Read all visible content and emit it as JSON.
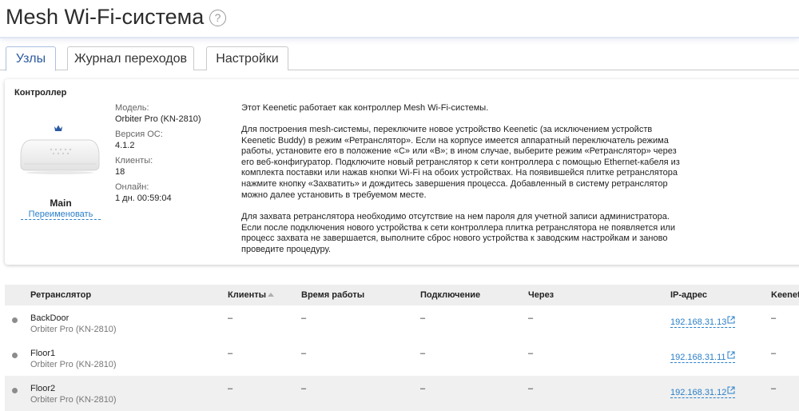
{
  "page": {
    "title": "Mesh Wi-Fi-система",
    "help_glyph": "?"
  },
  "tabs": [
    {
      "label": "Узлы",
      "active": true
    },
    {
      "label": "Журнал переходов",
      "active": false
    },
    {
      "label": "Настройки",
      "active": false
    }
  ],
  "controller": {
    "section_title": "Контроллер",
    "name": "Main",
    "rename_label": "Переименовать",
    "model_label": "Модель:",
    "model_value": "Orbiter Pro (KN-2810)",
    "os_label": "Версия ОС:",
    "os_value": "4.1.2",
    "clients_label": "Клиенты:",
    "clients_value": "18",
    "online_label": "Онлайн:",
    "online_value": "1 дн. 00:59:04",
    "description": [
      "Этот Keenetic работает как контроллер Mesh Wi-Fi-системы.",
      "Для построения mesh-системы, переключите новое устройство Keenetic (за исключением устройств Keenetic Buddy) в режим «Ретранслятор». Если на корпусе имеется аппаратный переключатель режима работы, установите его в положение «C» или «B»; в ином случае, выберите режим «Ретранслятор» через его веб-конфигуратор. Подключите новый ретранслятор к сети контроллера с помощью Ethernet-кабеля из комплекта поставки или нажав кнопки Wi-Fi на обоих устройствах. На появившейся плитке ретранслятора нажмите кнопку «Захватить» и дождитесь завершения процесса. Добавленный в систему ретранслятор можно далее установить в требуемом месте.",
      "Для захвата ретранслятора необходимо отсутствие на нем пароля для учетной записи администратора. Если после подключения нового устройства к сети контроллера плитка ретранслятора не появляется или процесс захвата не завершается, выполните сброс нового устройства к заводским настройкам и заново проведите процедуру."
    ]
  },
  "table": {
    "headers": {
      "repeater": "Ретранслятор",
      "clients": "Клиенты",
      "uptime": "Время работы",
      "connection": "Подключение",
      "via": "Через",
      "ip": "IP-адрес",
      "keenetic": "Keenetic"
    },
    "rows": [
      {
        "name": "BackDoor",
        "model": "Orbiter Pro (KN-2810)",
        "clients": "–",
        "uptime": "–",
        "connection": "–",
        "via": "–",
        "ip": "192.168.31.13",
        "keenetic": "–"
      },
      {
        "name": "Floor1",
        "model": "Orbiter Pro (KN-2810)",
        "clients": "–",
        "uptime": "–",
        "connection": "–",
        "via": "–",
        "ip": "192.168.31.11",
        "keenetic": "–"
      },
      {
        "name": "Floor2",
        "model": "Orbiter Pro (KN-2810)",
        "clients": "–",
        "uptime": "–",
        "connection": "–",
        "via": "–",
        "ip": "192.168.31.12",
        "keenetic": "–"
      }
    ]
  },
  "colors": {
    "link": "#2a7fc9",
    "active_tab": "#2c5aa0",
    "table_header_bg": "#eeeeee"
  },
  "icons": [
    "help-icon",
    "crown-icon",
    "router-image",
    "status-dot-icon",
    "external-link-icon",
    "sort-ascending-icon"
  ]
}
